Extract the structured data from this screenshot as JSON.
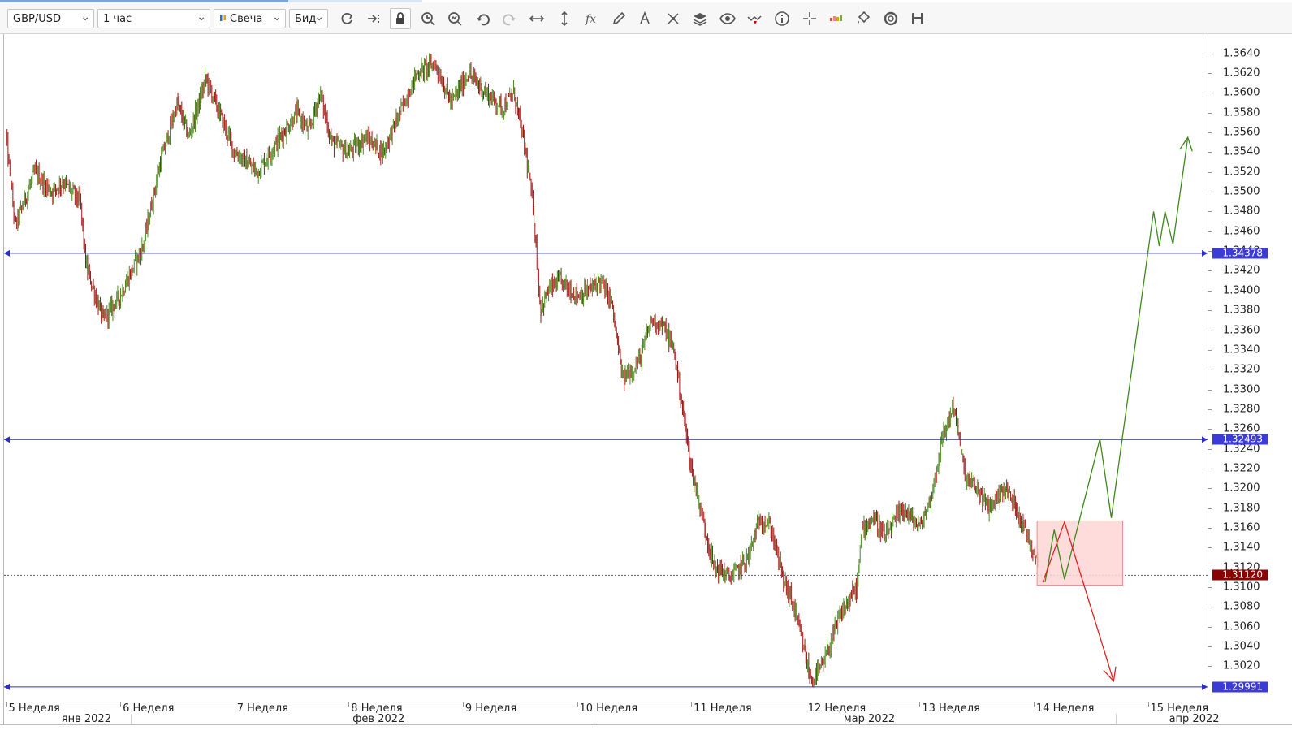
{
  "toolbar": {
    "symbol": "GBP/USD",
    "timeframe": "1 час",
    "chart_style": "Свеча",
    "price_type": "Бид",
    "icons": [
      "refresh-icon",
      "scroll-to-end-icon",
      "lock-icon",
      "zoom-time-icon",
      "zoom-price-icon",
      "undo-icon",
      "redo-icon",
      "horizontal-scale-icon",
      "vertical-scale-icon",
      "indicators-icon",
      "pencil-icon",
      "text-annotation-icon",
      "objects-icon",
      "layers-icon",
      "visibility-icon",
      "signals-icon",
      "info-icon",
      "crosshair-icon",
      "volume-icon",
      "fill-icon",
      "reset-icon",
      "save-icon"
    ]
  },
  "chart_data": {
    "type": "candlestick",
    "symbol": "GBP/USD",
    "timeframe": "1 час",
    "ylim": [
      1.2985,
      1.3654
    ],
    "yticks": [
      "1.3640",
      "1.3620",
      "1.3600",
      "1.3580",
      "1.3560",
      "1.3540",
      "1.3520",
      "1.3500",
      "1.3480",
      "1.3460",
      "1.3440",
      "1.3420",
      "1.3400",
      "1.3380",
      "1.3360",
      "1.3340",
      "1.3320",
      "1.3300",
      "1.3280",
      "1.3260",
      "1.3240",
      "1.3220",
      "1.3200",
      "1.3180",
      "1.3160",
      "1.3140",
      "1.3120",
      "1.3100",
      "1.3080",
      "1.3060",
      "1.3040",
      "1.3020"
    ],
    "week_labels": [
      {
        "label": "5 Неделя",
        "pos": 0
      },
      {
        "label": "6 Неделя",
        "pos": 1
      },
      {
        "label": "7 Неделя",
        "pos": 2
      },
      {
        "label": "8 Неделя",
        "pos": 3
      },
      {
        "label": "9 Неделя",
        "pos": 4
      },
      {
        "label": "10 Неделя",
        "pos": 5
      },
      {
        "label": "11 Неделя",
        "pos": 6
      },
      {
        "label": "12 Неделя",
        "pos": 7
      },
      {
        "label": "13 Неделя",
        "pos": 8
      },
      {
        "label": "14 Неделя",
        "pos": 9
      },
      {
        "label": "15 Неделя",
        "pos": 10
      }
    ],
    "month_labels": [
      {
        "label": "янв 2022",
        "pos": 0.45
      },
      {
        "label": "фев 2022",
        "pos": 3.0
      },
      {
        "label": "мар 2022",
        "pos": 7.3
      },
      {
        "label": "апр 2022",
        "pos": 10.15
      }
    ],
    "path": [
      [
        0,
        1.3555
      ],
      [
        0.08,
        1.3465
      ],
      [
        0.25,
        1.352
      ],
      [
        0.4,
        1.35
      ],
      [
        0.5,
        1.351
      ],
      [
        0.65,
        1.349
      ],
      [
        0.7,
        1.3425
      ],
      [
        0.85,
        1.337
      ],
      [
        1.0,
        1.3395
      ],
      [
        1.1,
        1.342
      ],
      [
        1.2,
        1.3445
      ],
      [
        1.35,
        1.353
      ],
      [
        1.5,
        1.359
      ],
      [
        1.6,
        1.3555
      ],
      [
        1.75,
        1.3615
      ],
      [
        1.85,
        1.3585
      ],
      [
        2.0,
        1.354
      ],
      [
        2.2,
        1.352
      ],
      [
        2.4,
        1.3555
      ],
      [
        2.55,
        1.358
      ],
      [
        2.65,
        1.356
      ],
      [
        2.75,
        1.36
      ],
      [
        2.85,
        1.355
      ],
      [
        3.0,
        1.354
      ],
      [
        3.15,
        1.3555
      ],
      [
        3.3,
        1.354
      ],
      [
        3.45,
        1.358
      ],
      [
        3.6,
        1.362
      ],
      [
        3.75,
        1.363
      ],
      [
        3.9,
        1.359
      ],
      [
        4.05,
        1.362
      ],
      [
        4.2,
        1.36
      ],
      [
        4.35,
        1.3585
      ],
      [
        4.45,
        1.36
      ],
      [
        4.55,
        1.354
      ],
      [
        4.62,
        1.348
      ],
      [
        4.68,
        1.338
      ],
      [
        4.75,
        1.34
      ],
      [
        4.85,
        1.341
      ],
      [
        5.0,
        1.3395
      ],
      [
        5.1,
        1.34
      ],
      [
        5.2,
        1.341
      ],
      [
        5.3,
        1.339
      ],
      [
        5.4,
        1.331
      ],
      [
        5.55,
        1.333
      ],
      [
        5.65,
        1.337
      ],
      [
        5.75,
        1.3365
      ],
      [
        5.85,
        1.334
      ],
      [
        5.95,
        1.326
      ],
      [
        6.0,
        1.322
      ],
      [
        6.1,
        1.317
      ],
      [
        6.2,
        1.312
      ],
      [
        6.35,
        1.311
      ],
      [
        6.5,
        1.313
      ],
      [
        6.6,
        1.317
      ],
      [
        6.7,
        1.316
      ],
      [
        6.8,
        1.311
      ],
      [
        6.9,
        1.308
      ],
      [
        7.0,
        1.303
      ],
      [
        7.05,
        1.3005
      ],
      [
        7.15,
        1.302
      ],
      [
        7.3,
        1.307
      ],
      [
        7.45,
        1.31
      ],
      [
        7.5,
        1.316
      ],
      [
        7.6,
        1.317
      ],
      [
        7.7,
        1.315
      ],
      [
        7.85,
        1.318
      ],
      [
        8.0,
        1.316
      ],
      [
        8.1,
        1.319
      ],
      [
        8.2,
        1.325
      ],
      [
        8.3,
        1.3285
      ],
      [
        8.4,
        1.321
      ],
      [
        8.5,
        1.32
      ],
      [
        8.6,
        1.318
      ],
      [
        8.75,
        1.32
      ],
      [
        8.85,
        1.318
      ],
      [
        8.95,
        1.315
      ],
      [
        9.05,
        1.3125
      ]
    ],
    "last_price": "1.31120",
    "horizontal_levels": [
      {
        "value": 1.34378,
        "label": "1.34378"
      },
      {
        "value": 1.32493,
        "label": "1.32493"
      },
      {
        "value": 1.29991,
        "label": "1.29991"
      }
    ],
    "zone": {
      "x_from": 9.03,
      "x_to": 9.78,
      "y_from": 1.3102,
      "y_to": 1.3167
    },
    "green_scenario": [
      [
        9.1,
        1.3105
      ],
      [
        9.18,
        1.3158
      ],
      [
        9.27,
        1.3108
      ],
      [
        9.58,
        1.325
      ],
      [
        9.68,
        1.317
      ],
      [
        10.05,
        1.348
      ],
      [
        10.1,
        1.3445
      ],
      [
        10.15,
        1.348
      ],
      [
        10.22,
        1.3447
      ],
      [
        10.35,
        1.3555
      ]
    ],
    "red_scenario": [
      [
        9.08,
        1.3105
      ],
      [
        9.27,
        1.3166
      ],
      [
        9.7,
        1.3005
      ]
    ],
    "colors": {
      "bull": "#4b8a1e",
      "bear": "#a31515",
      "level": "#2d2dcc",
      "badge_level": "#3b3bd6",
      "badge_price": "#8b0000",
      "green_path": "#3d8a1a",
      "red_path": "#e52020",
      "zone_fill": "#ffd6d6",
      "zone_border": "#f08c8c"
    }
  }
}
